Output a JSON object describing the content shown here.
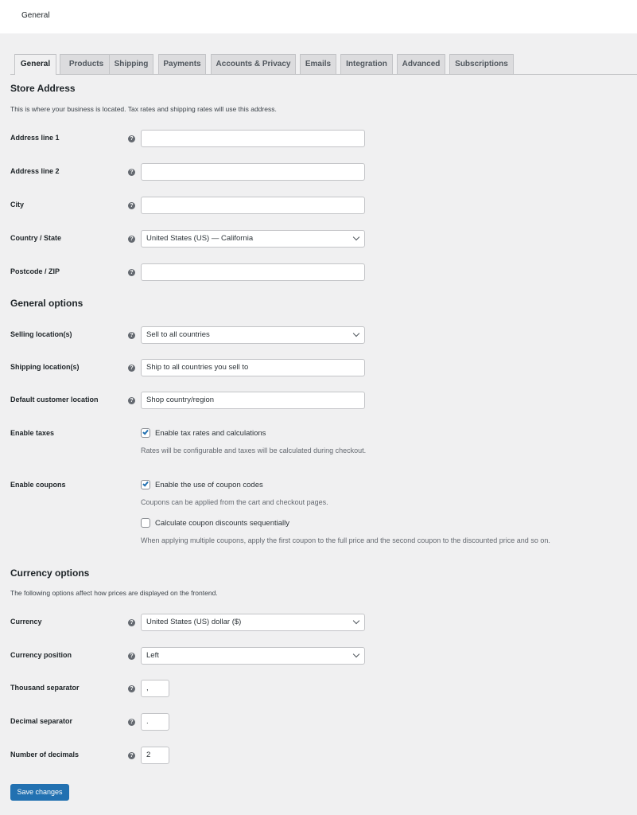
{
  "header": {
    "title": "General"
  },
  "tabs": [
    {
      "label": "General",
      "active": true
    },
    {
      "label": "Products"
    },
    {
      "label": "Shipping"
    },
    {
      "label": "Payments"
    },
    {
      "label": "Accounts & Privacy"
    },
    {
      "label": "Emails"
    },
    {
      "label": "Integration"
    },
    {
      "label": "Advanced"
    },
    {
      "label": "Subscriptions"
    }
  ],
  "store_address": {
    "heading": "Store Address",
    "description": "This is where your business is located. Tax rates and shipping rates will use this address.",
    "address_line_1": {
      "label": "Address line 1",
      "value": ""
    },
    "address_line_2": {
      "label": "Address line 2",
      "value": ""
    },
    "city": {
      "label": "City",
      "value": ""
    },
    "country_state": {
      "label": "Country / State",
      "value": "United States (US) — California"
    },
    "postcode": {
      "label": "Postcode / ZIP",
      "value": ""
    }
  },
  "general_options": {
    "heading": "General options",
    "selling_locations": {
      "label": "Selling location(s)",
      "value": "Sell to all countries"
    },
    "shipping_locations": {
      "label": "Shipping location(s)",
      "value": "Ship to all countries you sell to"
    },
    "default_customer_location": {
      "label": "Default customer location",
      "value": "Shop country/region"
    },
    "enable_taxes": {
      "label": "Enable taxes",
      "checkbox_label": "Enable tax rates and calculations",
      "checked": true,
      "description": "Rates will be configurable and taxes will be calculated during checkout."
    },
    "enable_coupons": {
      "label": "Enable coupons",
      "checkbox_label": "Enable the use of coupon codes",
      "checked": true,
      "description": "Coupons can be applied from the cart and checkout pages.",
      "sequential_label": "Calculate coupon discounts sequentially",
      "sequential_checked": false,
      "sequential_description": "When applying multiple coupons, apply the first coupon to the full price and the second coupon to the discounted price and so on."
    }
  },
  "currency_options": {
    "heading": "Currency options",
    "description": "The following options affect how prices are displayed on the frontend.",
    "currency": {
      "label": "Currency",
      "value": "United States (US) dollar ($)"
    },
    "currency_position": {
      "label": "Currency position",
      "value": "Left"
    },
    "thousand_separator": {
      "label": "Thousand separator",
      "value": ","
    },
    "decimal_separator": {
      "label": "Decimal separator",
      "value": "."
    },
    "number_of_decimals": {
      "label": "Number of decimals",
      "value": "2"
    }
  },
  "help_icon_glyph": "?",
  "save_button": {
    "label": "Save changes"
  },
  "colors": {
    "accent": "#2271b1",
    "background": "#f0f0f1",
    "tab_inactive": "#dcdcde"
  }
}
